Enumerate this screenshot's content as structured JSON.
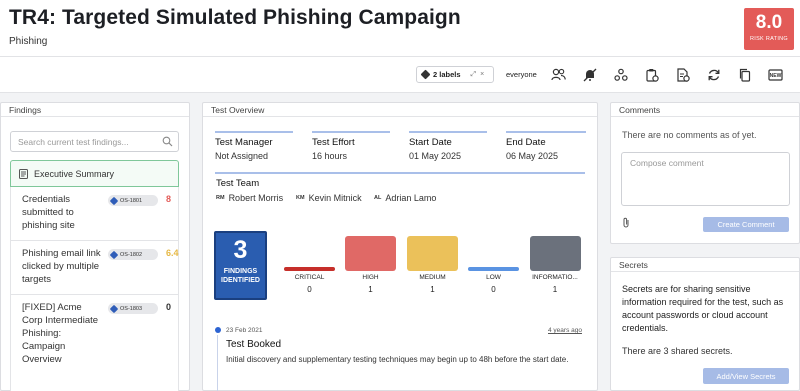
{
  "header": {
    "title": "TR4: Targeted Simulated Phishing Campaign",
    "subtitle": "Phishing",
    "risk_value": "8.0",
    "risk_label": "RISK RATING",
    "risk_color": "#e35b58"
  },
  "toolbar": {
    "labels_chip": "2 labels",
    "labels_edit": "⤢",
    "labels_remove": "×",
    "audience": "everyone",
    "buttons": [
      "users-icon",
      "mute-icon",
      "org-icon",
      "clipboard-settings-icon",
      "report-settings-icon",
      "refresh-icon",
      "copy-icon",
      "new-icon"
    ],
    "new_label": "NEW"
  },
  "findings": {
    "heading": "Findings",
    "search_placeholder": "Search current test findings...",
    "executive_summary": "Executive Summary",
    "items": [
      {
        "title": "Credentials submitted to phishing site",
        "tag": "OS-1801",
        "score": "8",
        "score_color": "#e35b58"
      },
      {
        "title": "Phishing email link clicked by multiple targets",
        "tag": "OS-1802",
        "score": "6.4",
        "score_color": "#e6b845"
      },
      {
        "title": "[FIXED] Acme Corp Intermediate Phishing: Campaign Overview",
        "tag": "OS-1803",
        "score": "0",
        "score_color": "#333333"
      }
    ]
  },
  "overview": {
    "heading": "Test Overview",
    "stats": [
      {
        "label": "Test Manager",
        "value": "Not Assigned"
      },
      {
        "label": "Test Effort",
        "value": "16 hours"
      },
      {
        "label": "Start Date",
        "value": "01 May 2025"
      },
      {
        "label": "End Date",
        "value": "06 May 2025"
      }
    ],
    "team_title": "Test Team",
    "team": [
      {
        "initials": "RM",
        "name": "Robert Morris"
      },
      {
        "initials": "KM",
        "name": "Kevin Mitnick"
      },
      {
        "initials": "AL",
        "name": "Adrian Lamo"
      }
    ],
    "findings_count": "3",
    "findings_label": "FINDINGS IDENTIFIED",
    "severities": [
      {
        "label": "CRITICAL",
        "count": "0",
        "color": "#c62f2a"
      },
      {
        "label": "HIGH",
        "count": "1",
        "color": "#e06966"
      },
      {
        "label": "MEDIUM",
        "count": "1",
        "color": "#ebc15a"
      },
      {
        "label": "LOW",
        "count": "0",
        "color": "#5a93e2"
      },
      {
        "label": "INFORMATIO...",
        "count": "1",
        "color": "#6b717c"
      }
    ],
    "event": {
      "date": "23 Feb 2021",
      "ago": "4 years ago",
      "title": "Test Booked",
      "body": "Initial discovery and supplementary testing techniques may begin up to 48h before the start date."
    }
  },
  "comments": {
    "heading": "Comments",
    "empty_text": "There are no comments as of yet.",
    "compose_placeholder": "Compose comment",
    "create_label": "Create Comment"
  },
  "secrets": {
    "heading": "Secrets",
    "description": "Secrets are for sharing sensitive information required for the test, such as account passwords or cloud account credentials.",
    "count_text": "There are 3 shared secrets.",
    "button_label": "Add/View Secrets"
  }
}
